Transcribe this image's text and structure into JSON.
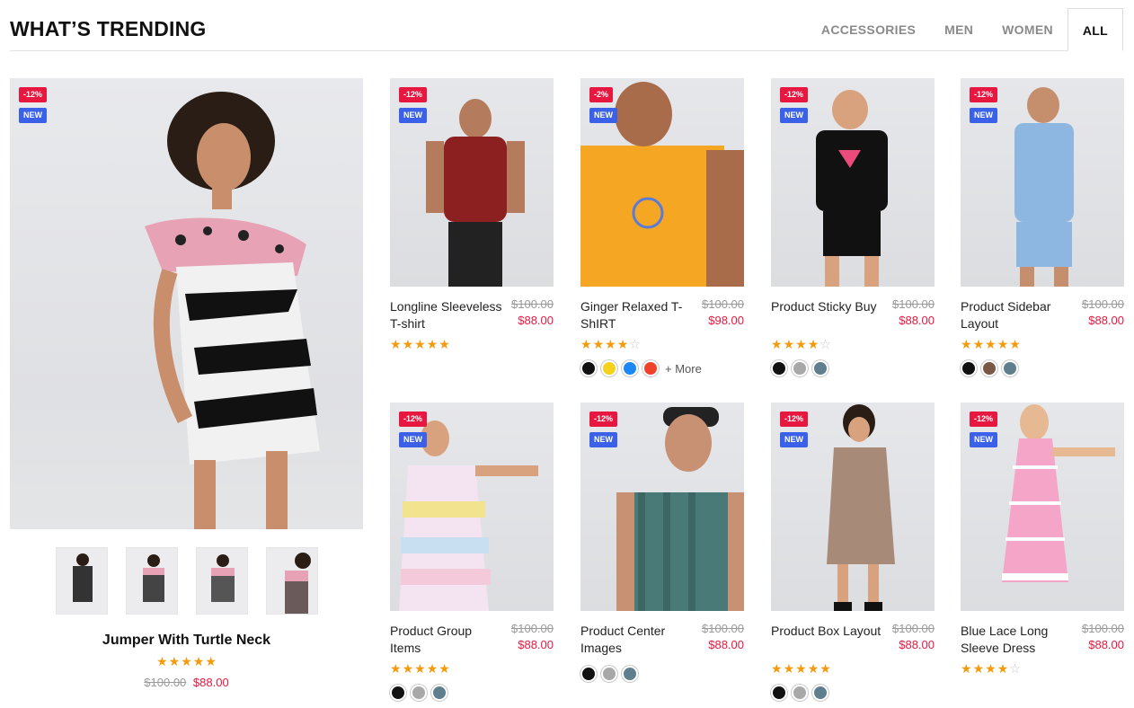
{
  "section": {
    "title": "WHAT’S TRENDING"
  },
  "tabs": [
    {
      "label": "ACCESSORIES",
      "active": false
    },
    {
      "label": "MEN",
      "active": false
    },
    {
      "label": "WOMEN",
      "active": false
    },
    {
      "label": "ALL",
      "active": true
    }
  ],
  "featured": {
    "sale_badge": "-12%",
    "new_badge": "NEW",
    "name": "Jumper With Turtle Neck",
    "old_price": "$100.00",
    "new_price": "$88.00",
    "rating": 5,
    "thumbnails": 4
  },
  "colors": {
    "sale": "#e8173f",
    "new": "#3a61e8",
    "star": "#f59a0b"
  },
  "products": [
    {
      "name": "Longline Sleeveless T-shirt",
      "old_price": "$100.00",
      "new_price": "$88.00",
      "sale_badge": "-12%",
      "new_badge": "NEW",
      "rating": 5,
      "swatches": [],
      "more": ""
    },
    {
      "name": "Ginger Relaxed T-ShIRT",
      "old_price": "$100.00",
      "new_price": "$98.00",
      "sale_badge": "-2%",
      "new_badge": "NEW",
      "rating": 4,
      "swatches": [
        "#111111",
        "#f6d21c",
        "#1e88f2",
        "#f0412a"
      ],
      "more": "+ More"
    },
    {
      "name": "Product Sticky Buy",
      "old_price": "$100.00",
      "new_price": "$88.00",
      "sale_badge": "-12%",
      "new_badge": "NEW",
      "rating": 4,
      "swatches": [
        "#111111",
        "#a8a8a8",
        "#5f7f8f"
      ],
      "more": ""
    },
    {
      "name": "Product Sidebar Layout",
      "old_price": "$100.00",
      "new_price": "$88.00",
      "sale_badge": "-12%",
      "new_badge": "NEW",
      "rating": 5,
      "swatches": [
        "#111111",
        "#7a5846",
        "#5f7f8f"
      ],
      "more": ""
    },
    {
      "name": "Product Group Items",
      "old_price": "$100.00",
      "new_price": "$88.00",
      "sale_badge": "-12%",
      "new_badge": "NEW",
      "rating": 5,
      "swatches": [
        "#111111",
        "#a8a8a8",
        "#5f7f8f"
      ],
      "more": ""
    },
    {
      "name": "Product Center Images",
      "old_price": "$100.00",
      "new_price": "$88.00",
      "sale_badge": "-12%",
      "new_badge": "NEW",
      "rating": 0,
      "swatches": [
        "#111111",
        "#a8a8a8",
        "#5f7f8f"
      ],
      "more": ""
    },
    {
      "name": "Product Box Layout",
      "old_price": "$100.00",
      "new_price": "$88.00",
      "sale_badge": "-12%",
      "new_badge": "NEW",
      "rating": 5,
      "swatches": [
        "#111111",
        "#a8a8a8",
        "#5f7f8f"
      ],
      "more": ""
    },
    {
      "name": "Blue Lace Long Sleeve Dress",
      "old_price": "$100.00",
      "new_price": "$88.00",
      "sale_badge": "-12%",
      "new_badge": "NEW",
      "rating": 4,
      "swatches": [],
      "more": ""
    }
  ]
}
